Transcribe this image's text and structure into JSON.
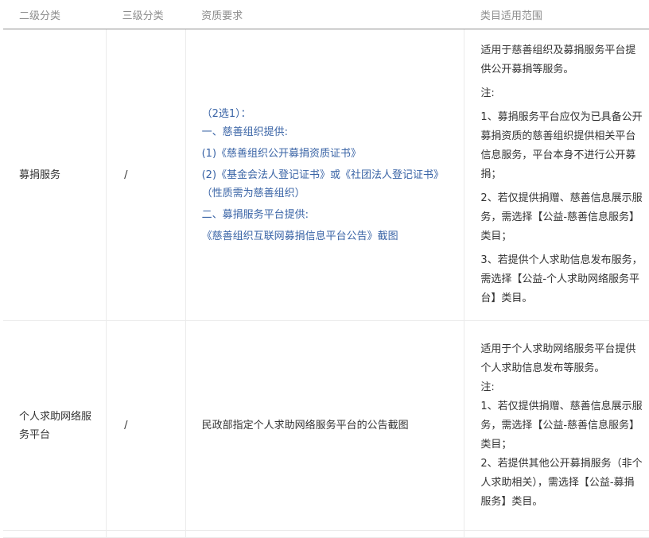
{
  "headers": [
    "二级分类",
    "三级分类",
    "资质要求",
    "类目适用范围"
  ],
  "rows": [
    {
      "secondary": "募捐服务",
      "tertiary": "/",
      "requirements": [
        "（2选1）：",
        "一、慈善组织提供:",
        "(1)《慈善组织公开募捐资质证书》",
        "(2)《基金会法人登记证书》或《社团法人登记证书》（性质需为慈善组织）",
        "二、募捐服务平台提供:",
        "《慈善组织互联网募捐信息平台公告》截图"
      ],
      "scope": [
        "适用于慈善组织及募捐服务平台提供公开募捐等服务。",
        "注:",
        "1、募捐服务平台应仅为已具备公开募捐资质的慈善组织提供相关平台信息服务，平台本身不进行公开募捐；",
        "2、若仅提供捐赠、慈善信息展示服务，需选择【公益-慈善信息服务】类目；",
        "3、若提供个人求助信息发布服务，需选择【公益-个人求助网络服务平台】类目。"
      ]
    },
    {
      "secondary": "个人求助网络服务平台",
      "tertiary": "/",
      "requirements": [
        "民政部指定个人求助网络服务平台的公告截图"
      ],
      "scope": [
        "适用于个人求助网络服务平台提供个人求助信息发布等服务。",
        "注:",
        "1、若仅提供捐赠、慈善信息展示服务，需选择【公益-慈善信息服务】类目；",
        "2、若提供其他公开募捐服务（非个人求助相关），需选择【公益-募捐服务】类目。"
      ]
    }
  ]
}
